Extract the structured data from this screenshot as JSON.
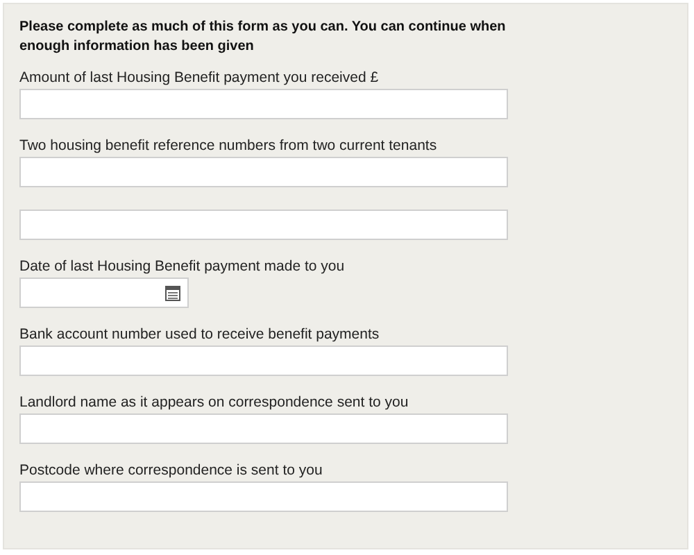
{
  "intro": "Please complete as much of this form as you can. You can continue when enough information has been given",
  "questions": [
    {
      "label": "Amount of last Housing Benefit payment you received £",
      "fields": [
        {
          "kind": "text"
        }
      ]
    },
    {
      "label": "Two housing benefit reference numbers from two current tenants",
      "fields": [
        {
          "kind": "text"
        },
        {
          "kind": "text"
        }
      ]
    },
    {
      "label": "Date of last Housing Benefit payment made to you",
      "fields": [
        {
          "kind": "date"
        }
      ]
    },
    {
      "label": "Bank account number used to receive benefit payments",
      "fields": [
        {
          "kind": "text"
        }
      ]
    },
    {
      "label": "Landlord name as it appears on correspondence sent to you",
      "fields": [
        {
          "kind": "text"
        }
      ]
    },
    {
      "label": "Postcode where correspondence is sent to you",
      "fields": [
        {
          "kind": "text"
        }
      ]
    }
  ]
}
